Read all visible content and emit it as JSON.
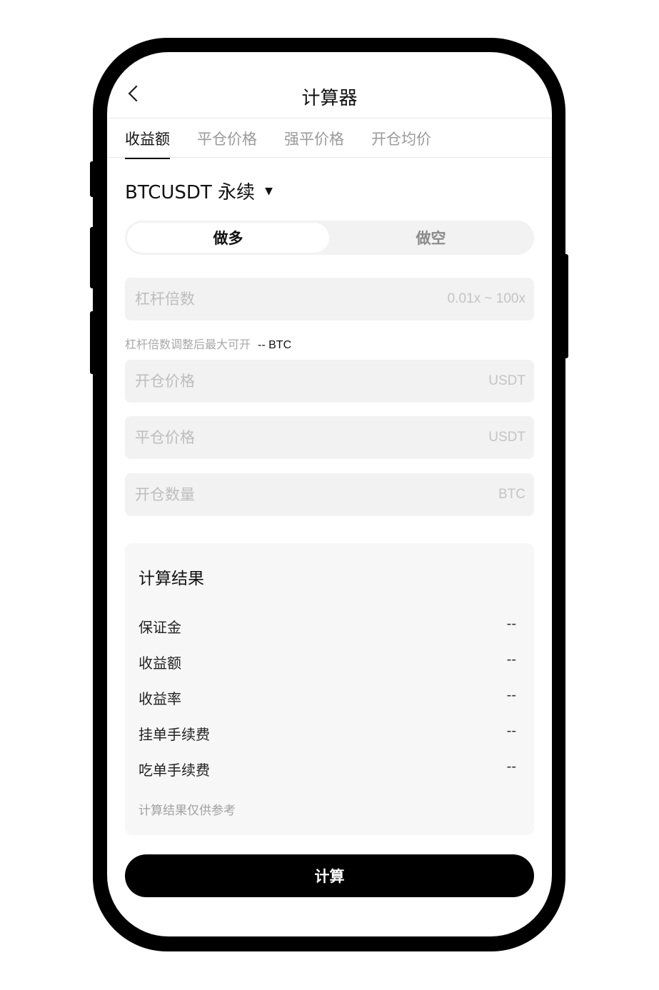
{
  "header": {
    "title": "计算器"
  },
  "tabs": [
    {
      "label": "收益额",
      "active": true
    },
    {
      "label": "平仓价格",
      "active": false
    },
    {
      "label": "强平价格",
      "active": false
    },
    {
      "label": "开仓均价",
      "active": false
    }
  ],
  "symbol": {
    "label": "BTCUSDT 永续",
    "caret": "▼"
  },
  "direction": {
    "long_label": "做多",
    "short_label": "做空",
    "selected": "long"
  },
  "fields": {
    "leverage": {
      "placeholder": "杠杆倍数",
      "unit": "0.01x ~ 100x",
      "value": ""
    },
    "open_price": {
      "placeholder": "开仓价格",
      "unit": "USDT",
      "value": ""
    },
    "close_price": {
      "placeholder": "平仓价格",
      "unit": "USDT",
      "value": ""
    },
    "quantity": {
      "placeholder": "开仓数量",
      "unit": "BTC",
      "value": ""
    }
  },
  "hint": {
    "label": "杠杆倍数调整后最大可开",
    "value": "-- BTC"
  },
  "result": {
    "title": "计算结果",
    "rows": [
      {
        "label": "保证金",
        "value": "--"
      },
      {
        "label": "收益额",
        "value": "--"
      },
      {
        "label": "收益率",
        "value": "--"
      },
      {
        "label": "挂单手续费",
        "value": "--"
      },
      {
        "label": "吃单手续费",
        "value": "--"
      }
    ],
    "note": "计算结果仅供参考"
  },
  "actions": {
    "calculate_label": "计算"
  },
  "colors": {
    "frame": "#000000",
    "primary_button": "#000000",
    "field_bg": "#f2f2f2",
    "panel_bg": "#f7f7f7",
    "muted_text": "#9a9a9a"
  }
}
